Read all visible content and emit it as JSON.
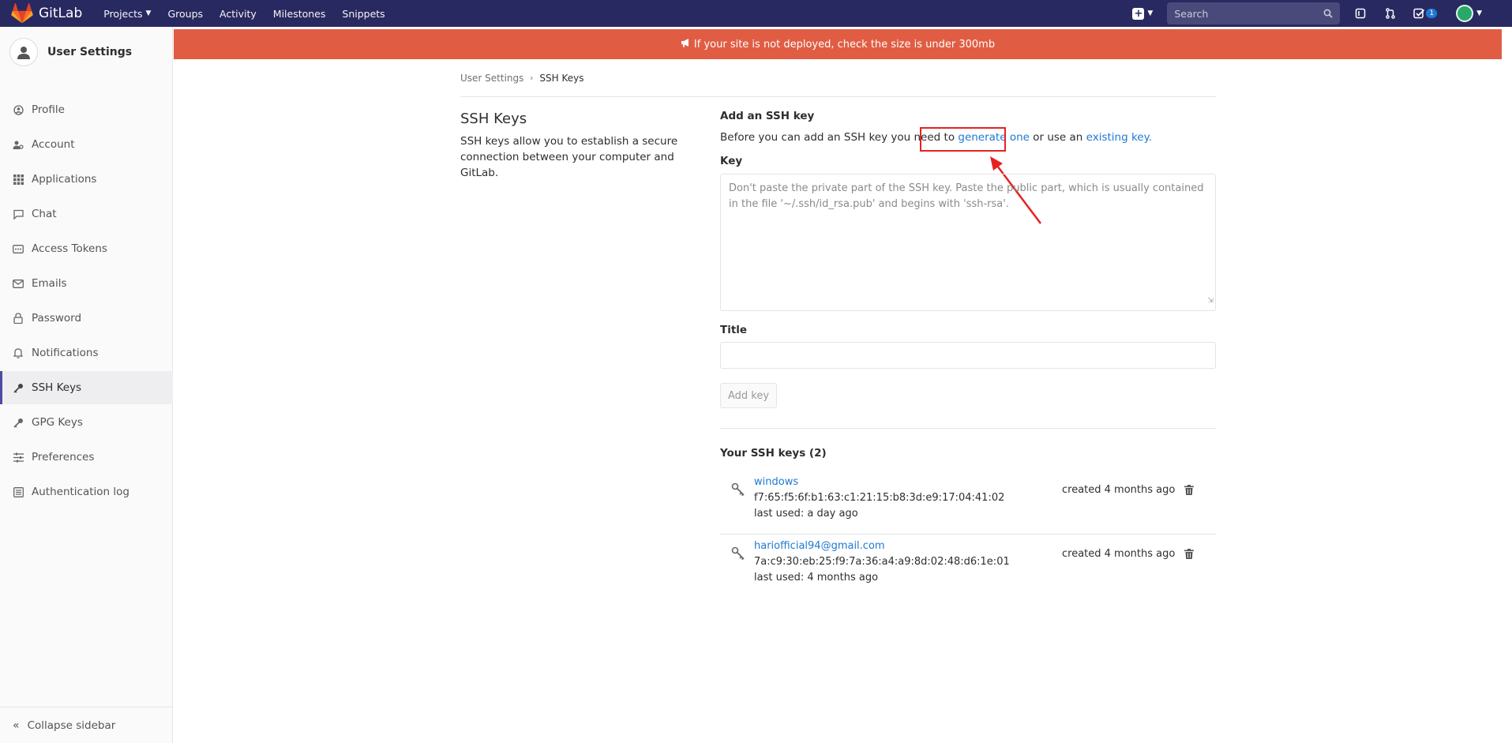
{
  "navbar": {
    "brand": "GitLab",
    "links": [
      {
        "label": "Projects",
        "caret": true
      },
      {
        "label": "Groups",
        "caret": false
      },
      {
        "label": "Activity",
        "caret": false
      },
      {
        "label": "Milestones",
        "caret": false
      },
      {
        "label": "Snippets",
        "caret": false
      }
    ],
    "search_placeholder": "Search",
    "todo_count": "1",
    "colors": {
      "bg": "#292961",
      "accent": "#1f78d1"
    }
  },
  "sidebar": {
    "title": "User Settings",
    "items": [
      {
        "label": "Profile",
        "icon": "profile-icon"
      },
      {
        "label": "Account",
        "icon": "account-icon"
      },
      {
        "label": "Applications",
        "icon": "applications-icon"
      },
      {
        "label": "Chat",
        "icon": "chat-icon"
      },
      {
        "label": "Access Tokens",
        "icon": "token-icon"
      },
      {
        "label": "Emails",
        "icon": "mail-icon"
      },
      {
        "label": "Password",
        "icon": "lock-icon"
      },
      {
        "label": "Notifications",
        "icon": "bell-icon"
      },
      {
        "label": "SSH Keys",
        "icon": "key-icon",
        "active": true
      },
      {
        "label": "GPG Keys",
        "icon": "key-icon"
      },
      {
        "label": "Preferences",
        "icon": "sliders-icon"
      },
      {
        "label": "Authentication log",
        "icon": "log-icon"
      }
    ],
    "collapse_label": "Collapse sidebar"
  },
  "banner": {
    "text": "If your site is not deployed, check the size is under 300mb",
    "color": "#e05d44"
  },
  "breadcrumb": {
    "parent": "User Settings",
    "current": "SSH Keys"
  },
  "intro": {
    "title": "SSH Keys",
    "description": "SSH keys allow you to establish a secure connection between your computer and GitLab."
  },
  "form": {
    "heading": "Add an SSH key",
    "desc_before": "Before you can add an SSH key you need to ",
    "generate_link": "generate one",
    "desc_middle": " or use an ",
    "existing_link": "existing key.",
    "key_label": "Key",
    "key_placeholder": "Don't paste the private part of the SSH key. Paste the public part, which is usually contained in the file '~/.ssh/id_rsa.pub' and begins with 'ssh-rsa'.",
    "title_label": "Title",
    "title_value": "",
    "submit_label": "Add key"
  },
  "keys": {
    "heading": "Your SSH keys (2)",
    "items": [
      {
        "name": "windows",
        "fingerprint": "f7:65:f5:6f:b1:63:c1:21:15:b8:3d:e9:17:04:41:02",
        "last_used": "last used: a day ago",
        "created": "created 4 months ago"
      },
      {
        "name": "hariofficial94@gmail.com",
        "fingerprint": "7a:c9:30:eb:25:f9:7a:36:a4:a9:8d:02:48:d6:1e:01",
        "last_used": "last used: 4 months ago",
        "created": "created 4 months ago"
      }
    ]
  }
}
